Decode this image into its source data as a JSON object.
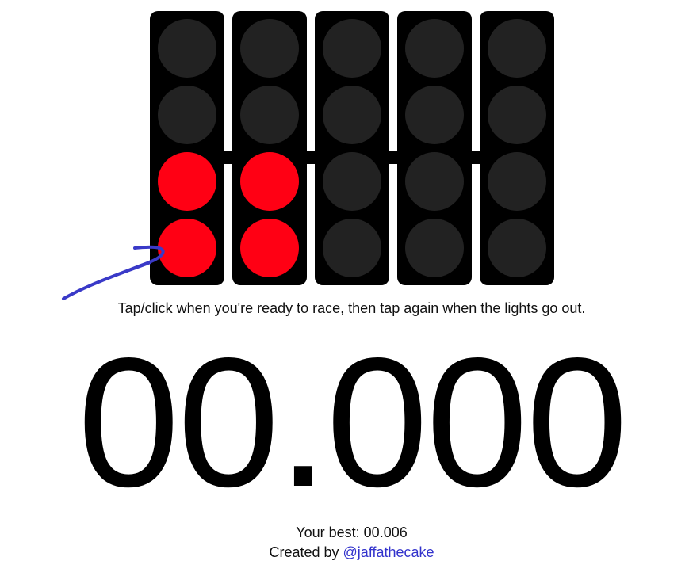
{
  "lights": {
    "pods": [
      {
        "lamps": [
          false,
          false,
          true,
          true
        ]
      },
      {
        "lamps": [
          false,
          false,
          true,
          true
        ]
      },
      {
        "lamps": [
          false,
          false,
          false,
          false
        ]
      },
      {
        "lamps": [
          false,
          false,
          false,
          false
        ]
      },
      {
        "lamps": [
          false,
          false,
          false,
          false
        ]
      }
    ],
    "on_color": "#ff0014",
    "off_color": "#222222",
    "housing_color": "#000000"
  },
  "instructions": "Tap/click when you're ready to race, then tap again when the lights go out.",
  "timer": "00.000",
  "best": {
    "label": "Your best:",
    "value": "00.006"
  },
  "credit": {
    "prefix": "Created by",
    "link_text": "@jaffathecake",
    "link_color": "#3333cc"
  },
  "annotation": {
    "color": "#3a3ac8"
  }
}
